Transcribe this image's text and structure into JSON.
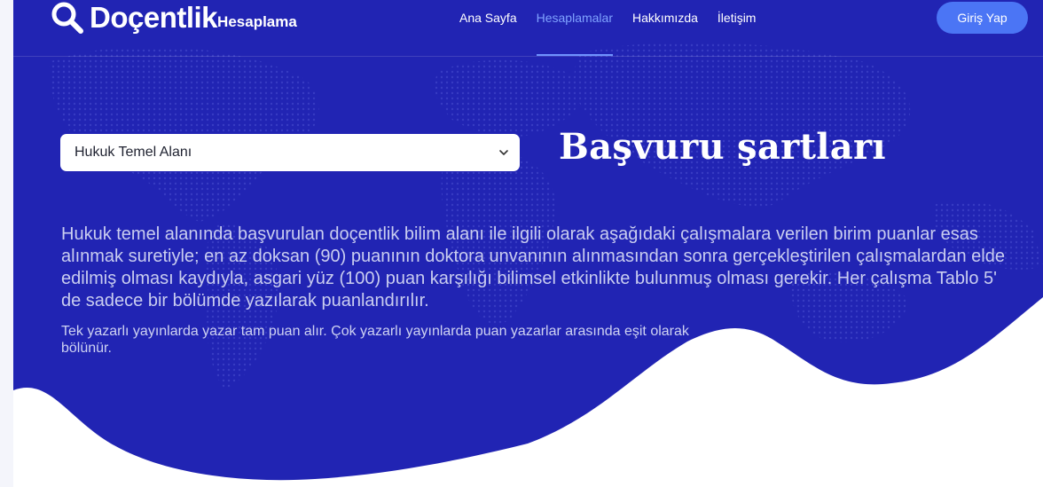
{
  "brand": {
    "name": "Doçentlik",
    "suffix": "Hesaplama",
    "icon": "search-icon"
  },
  "nav": {
    "items": [
      {
        "label": "Ana Sayfa",
        "active": false
      },
      {
        "label": "Hesaplamalar",
        "active": true
      },
      {
        "label": "Hakkımızda",
        "active": false
      },
      {
        "label": "İletişim",
        "active": false
      }
    ],
    "login_label": "Giriş Yap"
  },
  "field_select": {
    "selected": "Hukuk Temel Alanı",
    "icon": "chevron-down-icon"
  },
  "page_title": "Başvuru şartları",
  "content": {
    "main_text": "Hukuk temel alanında başvurulan doçentlik bilim alanı ile ilgili olarak aşağıdaki çalışmalara verilen birim puanlar esas alınmak suretiyle; en az doksan (90) puanının doktora unvanının alınmasından sonra gerçekleştirilen çalışmalardan elde edilmiş olması kaydıyla, asgari yüz (100) puan karşılığı bilimsel etkinlikte bulunmuş olması gerekir. Her çalışma Tablo 5' de sadece bir bölümde yazılarak puanlandırılır.",
    "note_text": "Tek yazarlı yayınlarda yazar tam puan alır. Çok yazarlı yayınlarda puan yazarlar arasında eşit olarak bölünür."
  },
  "colors": {
    "hero_bg": "#2124b3",
    "active_link": "#7fa2ff",
    "button_bg": "#4b75f5",
    "wave": "#ffffff"
  }
}
